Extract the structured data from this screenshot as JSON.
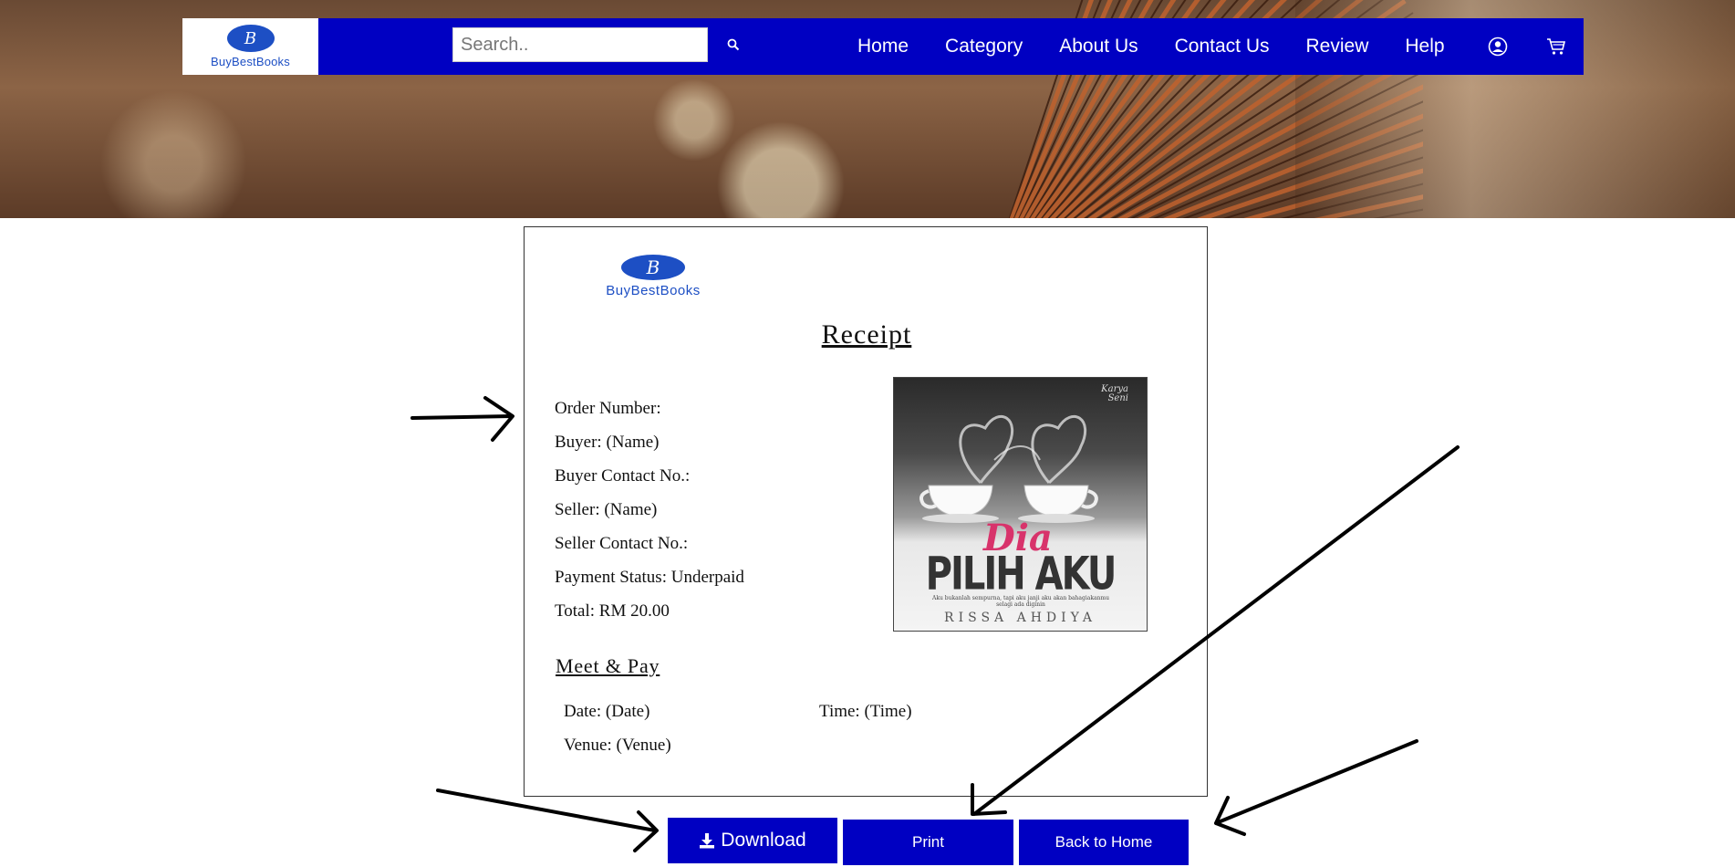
{
  "brand": {
    "name": "BuyBestBooks",
    "monogram": "B",
    "color": "#1d4fc4"
  },
  "colors": {
    "nav_bg": "#0000c2",
    "button_bg": "#0000c2"
  },
  "search": {
    "placeholder": "Search..",
    "icon": "search-icon"
  },
  "nav": {
    "items": [
      "Home",
      "Category",
      "About Us",
      "Contact Us",
      "Review",
      "Help"
    ],
    "icons": [
      "user-icon",
      "cart-icon"
    ]
  },
  "receipt": {
    "title": "Receipt",
    "fields": [
      "Order Number:",
      "Buyer: (Name)",
      "Buyer Contact No.:",
      "Seller: (Name)",
      "Seller Contact No.:",
      "Payment Status: Underpaid",
      "Total: RM 20.00"
    ],
    "book_cover": {
      "title_line1": "Dia",
      "title_line2": "PILIH AKU",
      "tagline": "Aku bukanlah sempurna, tapi aku janji aku akan bahagiakanmu selagi ada diginin",
      "author": "RISSA AHDIYA",
      "publisher_line1": "Karya",
      "publisher_line2": "Seni"
    },
    "meet_title": "Meet & Pay",
    "date": "Date: (Date)",
    "time": "Time: (Time)",
    "venue": "Venue: (Venue)"
  },
  "buttons": {
    "download": "Download",
    "print": "Print",
    "home": "Back to Home"
  }
}
